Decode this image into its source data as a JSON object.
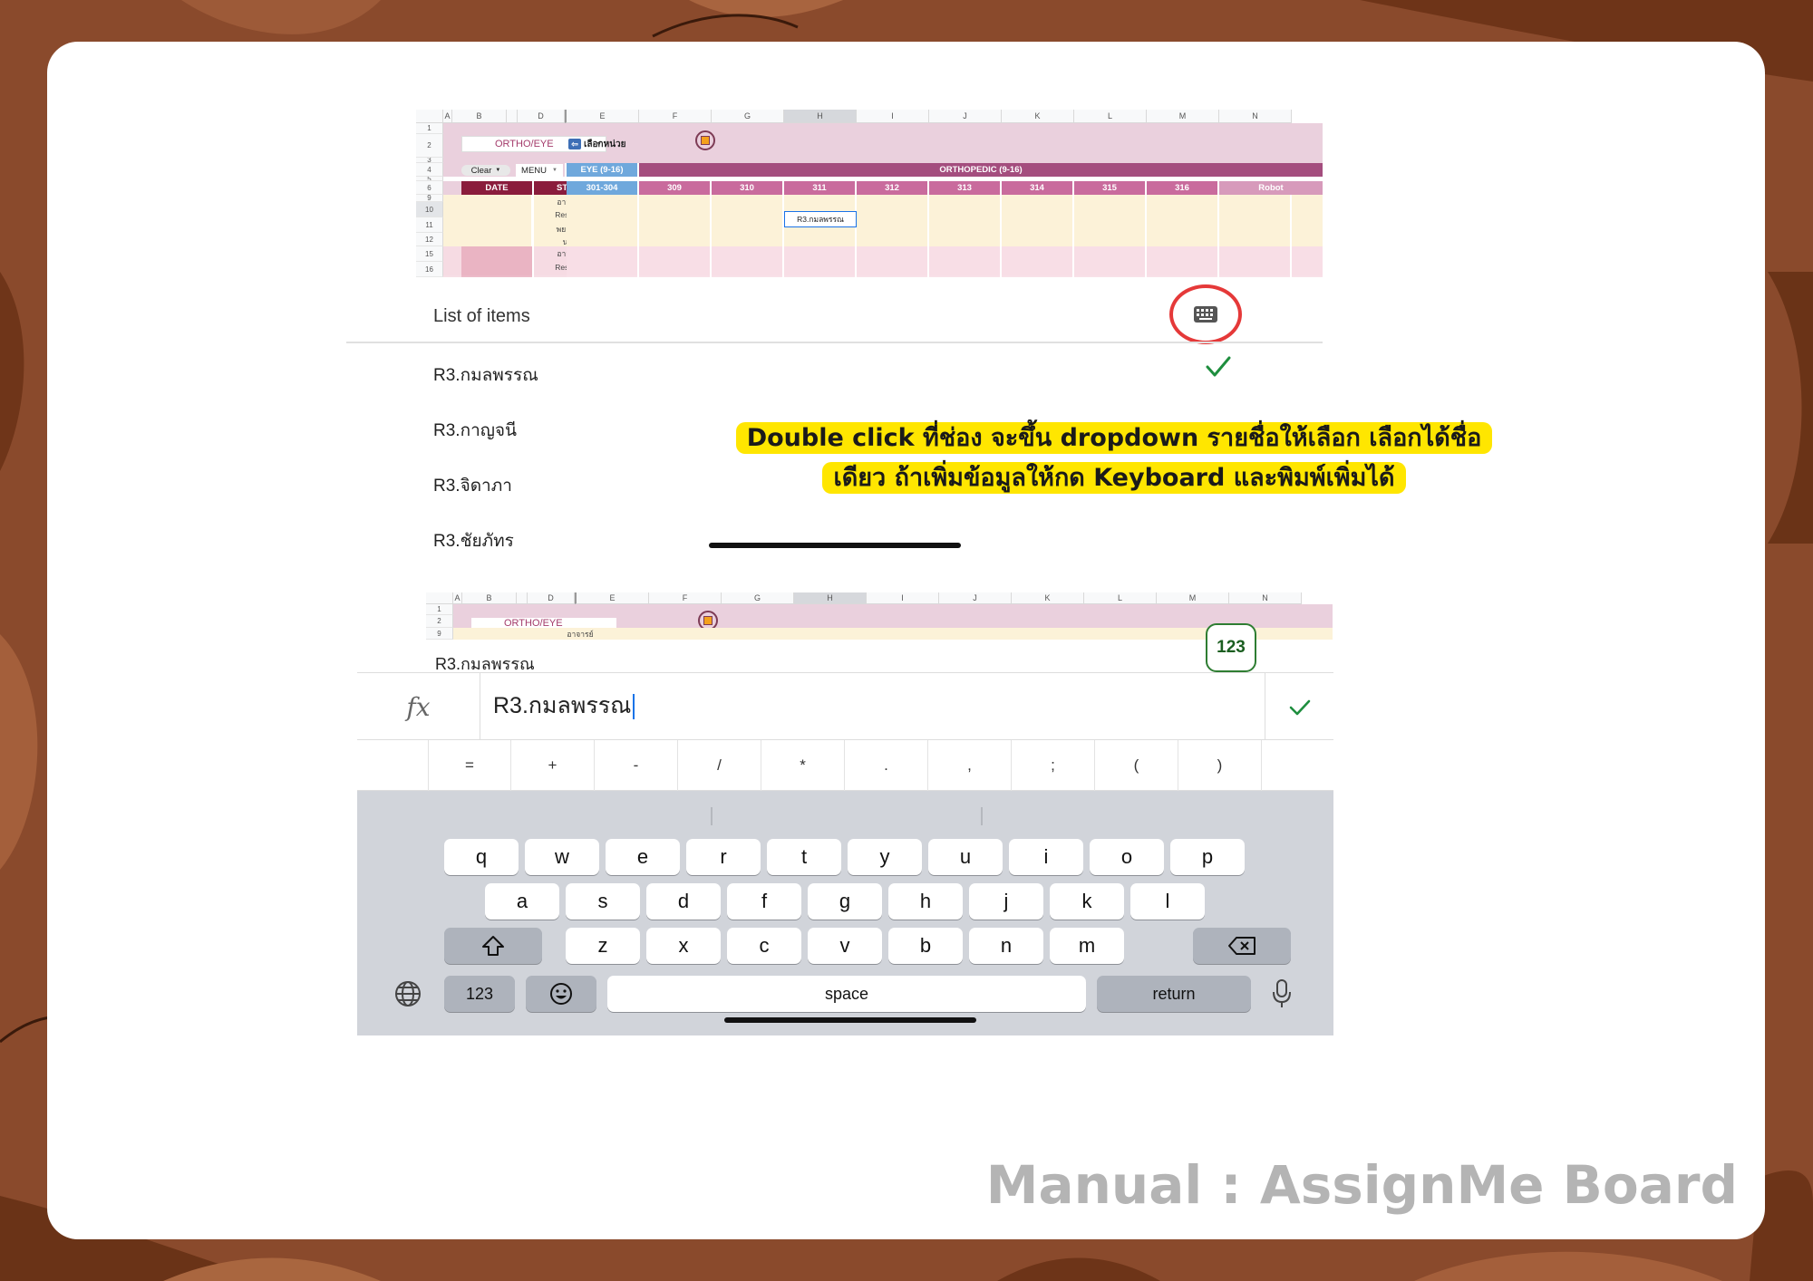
{
  "sheet": {
    "col_headers": [
      "A",
      "B",
      "",
      "D",
      "E",
      "F",
      "G",
      "H",
      "I",
      "J",
      "K",
      "L",
      "M",
      "N"
    ],
    "row_numbers": [
      "1",
      "2",
      "3",
      "4",
      "5",
      "6",
      "9",
      "10",
      "11",
      "12",
      "15",
      "16"
    ],
    "unit_dropdown": "ORTHO/EYE",
    "select_unit_label": "เลือกหน่วย",
    "clear_button": "Clear",
    "menu_dropdown": "MENU",
    "eye_header": "EYE (9-16)",
    "ortho_header": "ORTHOPEDIC (9-16)",
    "date_header": "DATE",
    "staff_header": "STAFF",
    "rooms": [
      "301-304",
      "309",
      "310",
      "311",
      "312",
      "313",
      "314",
      "315",
      "316",
      "Robot"
    ],
    "staff_roles": [
      "อาจารย์",
      "Resident",
      "พยาบาล",
      "นศพ",
      "อาจารย์",
      "Resident"
    ],
    "selected_cell_value": "R3.กมลพรรณ"
  },
  "list_panel": {
    "title": "List of items",
    "items": [
      "R3.กมลพรรณ",
      "R3.กาญจนี",
      "R3.จิดาภา",
      "R3.ชัยภัทร"
    ],
    "keyboard_icon": "keyboard-icon",
    "check_icon": "check-icon"
  },
  "callout": {
    "line1": "Double click ที่ช่อง จะขึ้น dropdown รายชื่อให้เลือก  เลือกได้ชื่อ",
    "line2": "เดียว ถ้าเพิ่มข้อมูลให้กด Keyboard และพิมพ์เพิ่มได้"
  },
  "sheet2": {
    "col_headers": [
      "A",
      "B",
      "",
      "D",
      "E",
      "F",
      "G",
      "H",
      "I",
      "J",
      "K",
      "L",
      "M",
      "N"
    ],
    "row_numbers": [
      "1",
      "2",
      "9"
    ],
    "unit_dropdown": "ORTHO/EYE",
    "staff_role": "อาจารย์"
  },
  "editor": {
    "cell_label": "R3.กมลพรรณ",
    "badge": "123",
    "fx_label": "fx",
    "input_value": "R3.กมลพรรณ",
    "symbols": [
      "=",
      "+",
      "-",
      "/",
      "*",
      ".",
      ",",
      ";",
      "(",
      ")"
    ]
  },
  "keyboard": {
    "row1": [
      "q",
      "w",
      "e",
      "r",
      "t",
      "y",
      "u",
      "i",
      "o",
      "p"
    ],
    "row2": [
      "a",
      "s",
      "d",
      "f",
      "g",
      "h",
      "j",
      "k",
      "l"
    ],
    "row3": [
      "z",
      "x",
      "c",
      "v",
      "b",
      "n",
      "m"
    ],
    "numbers_key": "123",
    "space_key": "space",
    "return_key": "return",
    "icons": [
      "globe-icon",
      "emoji-icon",
      "shift-icon",
      "backspace-icon",
      "microphone-icon"
    ]
  },
  "footer": {
    "title": "Manual : AssignMe Board"
  },
  "colors": {
    "background": "#8a4a2c",
    "pink_band": "#ead0dd",
    "staff_maroon": "#8a1c3c",
    "ortho_purple": "#a44d7e",
    "room_pink": "#c96b9d",
    "eye_blue": "#6fa8dc",
    "cream_rows": "#fcf2d8",
    "callout_yellow": "#ffe600",
    "accent_red": "#e53939",
    "check_green": "#1e8e3e"
  }
}
